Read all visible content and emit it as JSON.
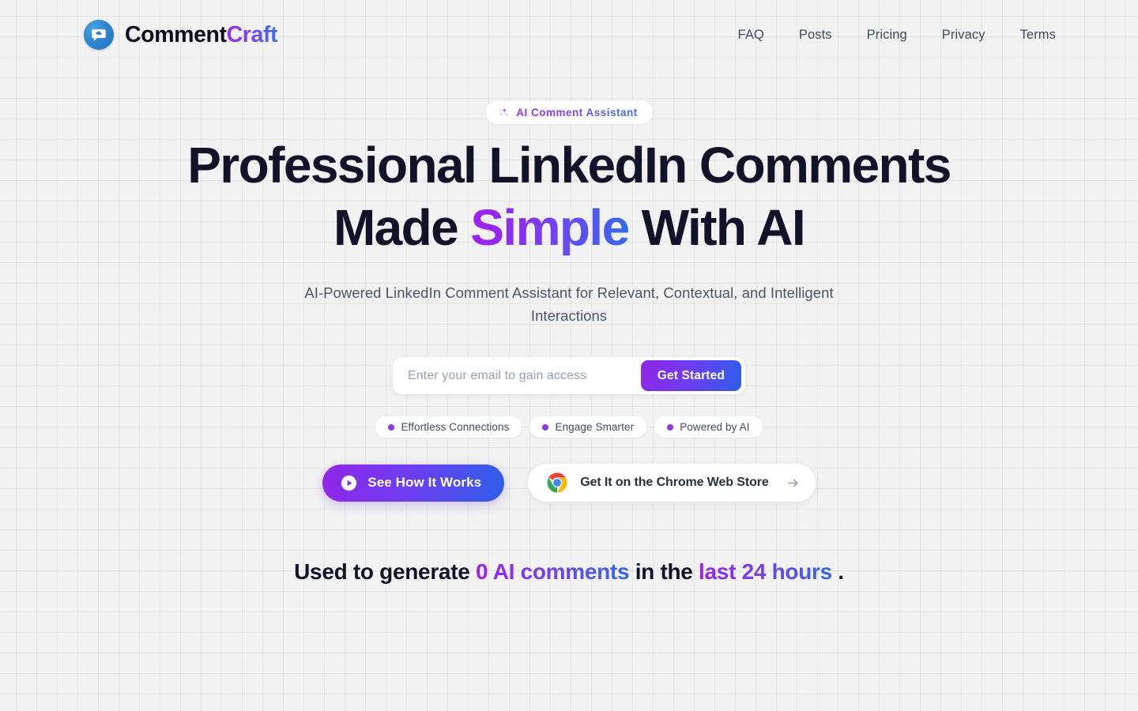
{
  "brand": {
    "name_primary": "Comment",
    "name_accent": "Craft",
    "logo_icon": "chat-bubble-icon"
  },
  "nav": {
    "items": [
      {
        "label": "FAQ"
      },
      {
        "label": "Posts"
      },
      {
        "label": "Pricing"
      },
      {
        "label": "Privacy"
      },
      {
        "label": "Terms"
      }
    ]
  },
  "hero": {
    "badge": {
      "icon": "sparkles-icon",
      "text": "AI Comment Assistant"
    },
    "headline_line1": "Professional LinkedIn Comments",
    "headline_line2_pre": "Made ",
    "headline_line2_accent": "Simple",
    "headline_line2_post": " With AI",
    "subhead": "AI-Powered LinkedIn Comment Assistant for Relevant, Contextual, and Intelligent Interactions",
    "signup": {
      "placeholder": "Enter your email to gain access",
      "value": "",
      "button_label": "Get Started"
    },
    "pills": [
      {
        "label": "Effortless Connections",
        "dot_color": "#9333ea"
      },
      {
        "label": "Engage Smarter",
        "dot_color": "#9333ea"
      },
      {
        "label": "Powered by AI",
        "dot_color": "#9333ea"
      }
    ],
    "cta_primary": {
      "label": "See How It Works",
      "icon": "play-circle-icon"
    },
    "cta_secondary": {
      "label": "Get It on the Chrome Web Store",
      "icon": "chrome-icon",
      "trailing_icon": "arrow-right-icon"
    },
    "stat": {
      "prefix": "Used to generate ",
      "highlight_count": "0 AI comments",
      "middle": " in the ",
      "highlight_period": "last 24 hours",
      "suffix": " ."
    }
  },
  "colors": {
    "background": "#f2f2f2",
    "grid_line": "#e4e4e4",
    "accent_purple": "#9333ea",
    "accent_blue": "#2d5fe8",
    "text_dark": "#121228",
    "text_muted": "#4a5568"
  }
}
